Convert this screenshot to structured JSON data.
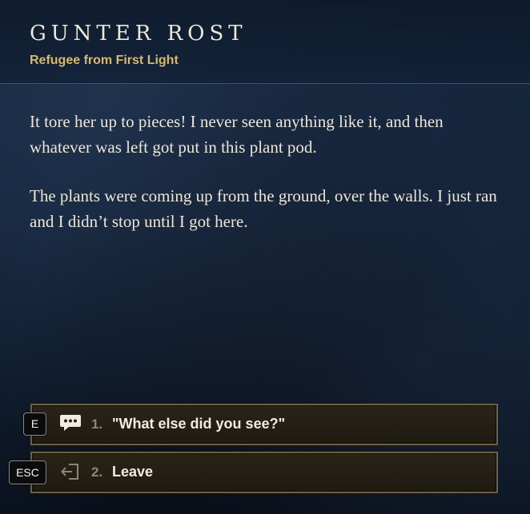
{
  "npc": {
    "name": "GUNTER ROST",
    "subtitle": "Refugee from First Light"
  },
  "dialogue": {
    "paragraphs": [
      "It tore her up to pieces! I never seen anything like it, and then whatever was left got put in this plant pod.",
      "The plants were coming up from the ground, over the walls. I just ran and I didn’t stop until I got here."
    ]
  },
  "options": [
    {
      "key": "E",
      "icon": "speech-bubble-icon",
      "number": "1.",
      "text": "\"What else did you see?\""
    },
    {
      "key": "ESC",
      "icon": "exit-door-icon",
      "number": "2.",
      "text": "Leave"
    }
  ],
  "colors": {
    "name": "#efe7d6",
    "subtitle": "#d9b96a",
    "body_text": "#ede6d6",
    "option_border": "#6f6140",
    "option_number": "#8d8675"
  }
}
